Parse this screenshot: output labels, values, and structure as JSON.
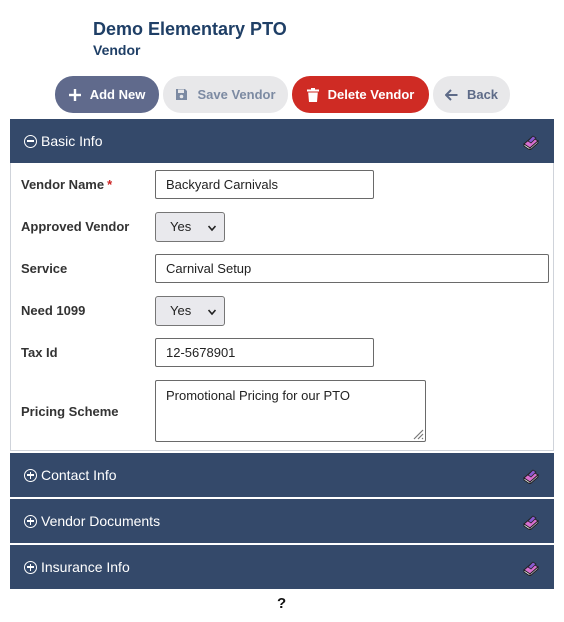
{
  "header": {
    "title": "Demo Elementary PTO",
    "subtitle": "Vendor"
  },
  "toolbar": {
    "add_label": "Add New",
    "save_label": "Save Vendor",
    "delete_label": "Delete Vendor",
    "back_label": "Back"
  },
  "sections": {
    "basic": "Basic Info",
    "contact": "Contact Info",
    "documents": "Vendor Documents",
    "insurance": "Insurance Info"
  },
  "form": {
    "vendor_name": {
      "label": "Vendor Name",
      "required_mark": "*",
      "value": "Backyard Carnivals"
    },
    "approved_vendor": {
      "label": "Approved Vendor",
      "value": "Yes"
    },
    "service": {
      "label": "Service",
      "value": "Carnival Setup"
    },
    "need_1099": {
      "label": "Need 1099",
      "value": "Yes"
    },
    "tax_id": {
      "label": "Tax Id",
      "value": "12-5678901"
    },
    "pricing_scheme": {
      "label": "Pricing Scheme",
      "value": "Promotional Pricing for our PTO"
    }
  },
  "footer": {
    "help": "?"
  },
  "colors": {
    "panel_header": "#34496a",
    "title": "#1f3f66",
    "add_button": "#606a8c",
    "delete_button": "#cf2b24",
    "neutral_button": "#e8e8ea"
  },
  "icons": {
    "add": "plus-icon",
    "save": "floppy-disk-icon",
    "delete": "trash-icon",
    "back": "arrow-left-icon",
    "section_help": "book-icon",
    "expanded": "circle-minus-icon",
    "collapsed": "circle-plus-icon"
  }
}
